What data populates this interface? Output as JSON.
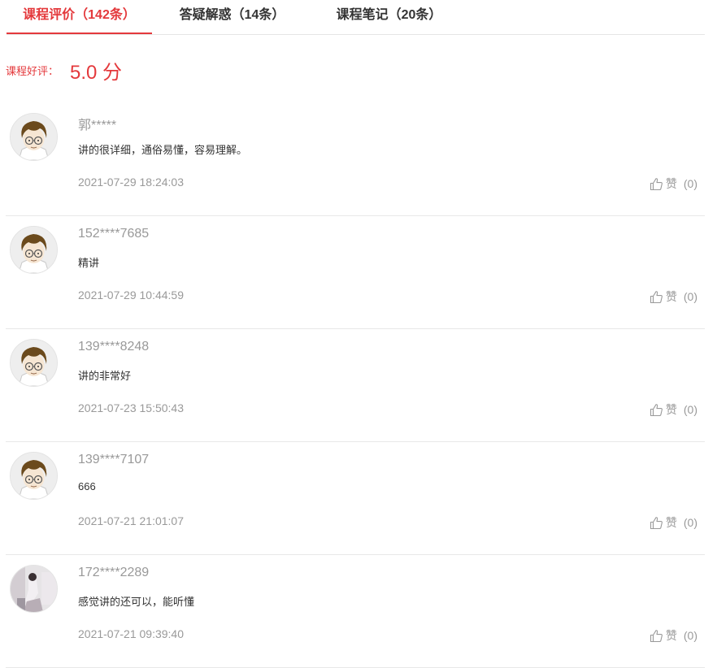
{
  "tabs": [
    {
      "label": "课程评价（142条）",
      "active": true
    },
    {
      "label": "答疑解惑（14条）",
      "active": false
    },
    {
      "label": "课程笔记（20条）",
      "active": false
    }
  ],
  "rating": {
    "label": "课程好评：",
    "score": "5.0 分"
  },
  "reviews": [
    {
      "user": "郭*****",
      "content": "讲的很详细，通俗易懂，容易理解。",
      "time": "2021-07-29 18:24:03",
      "like_label": "赞",
      "like_count": "(0)",
      "avatar": "cartoon-boy-avatar"
    },
    {
      "user": "152****7685",
      "content": "精讲",
      "time": "2021-07-29 10:44:59",
      "like_label": "赞",
      "like_count": "(0)",
      "avatar": "cartoon-boy-avatar"
    },
    {
      "user": "139****8248",
      "content": "讲的非常好",
      "time": "2021-07-23 15:50:43",
      "like_label": "赞",
      "like_count": "(0)",
      "avatar": "cartoon-boy-avatar"
    },
    {
      "user": "139****7107",
      "content": "666",
      "time": "2021-07-21 21:01:07",
      "like_label": "赞",
      "like_count": "(0)",
      "avatar": "cartoon-boy-avatar"
    },
    {
      "user": "172****2289",
      "content": "感觉讲的还可以，能听懂",
      "time": "2021-07-21 09:39:40",
      "like_label": "赞",
      "like_count": "(0)",
      "avatar": "photo-avatar"
    }
  ],
  "colors": {
    "accent": "#e4393c",
    "muted": "#999999",
    "divider": "#e8e8e8"
  }
}
